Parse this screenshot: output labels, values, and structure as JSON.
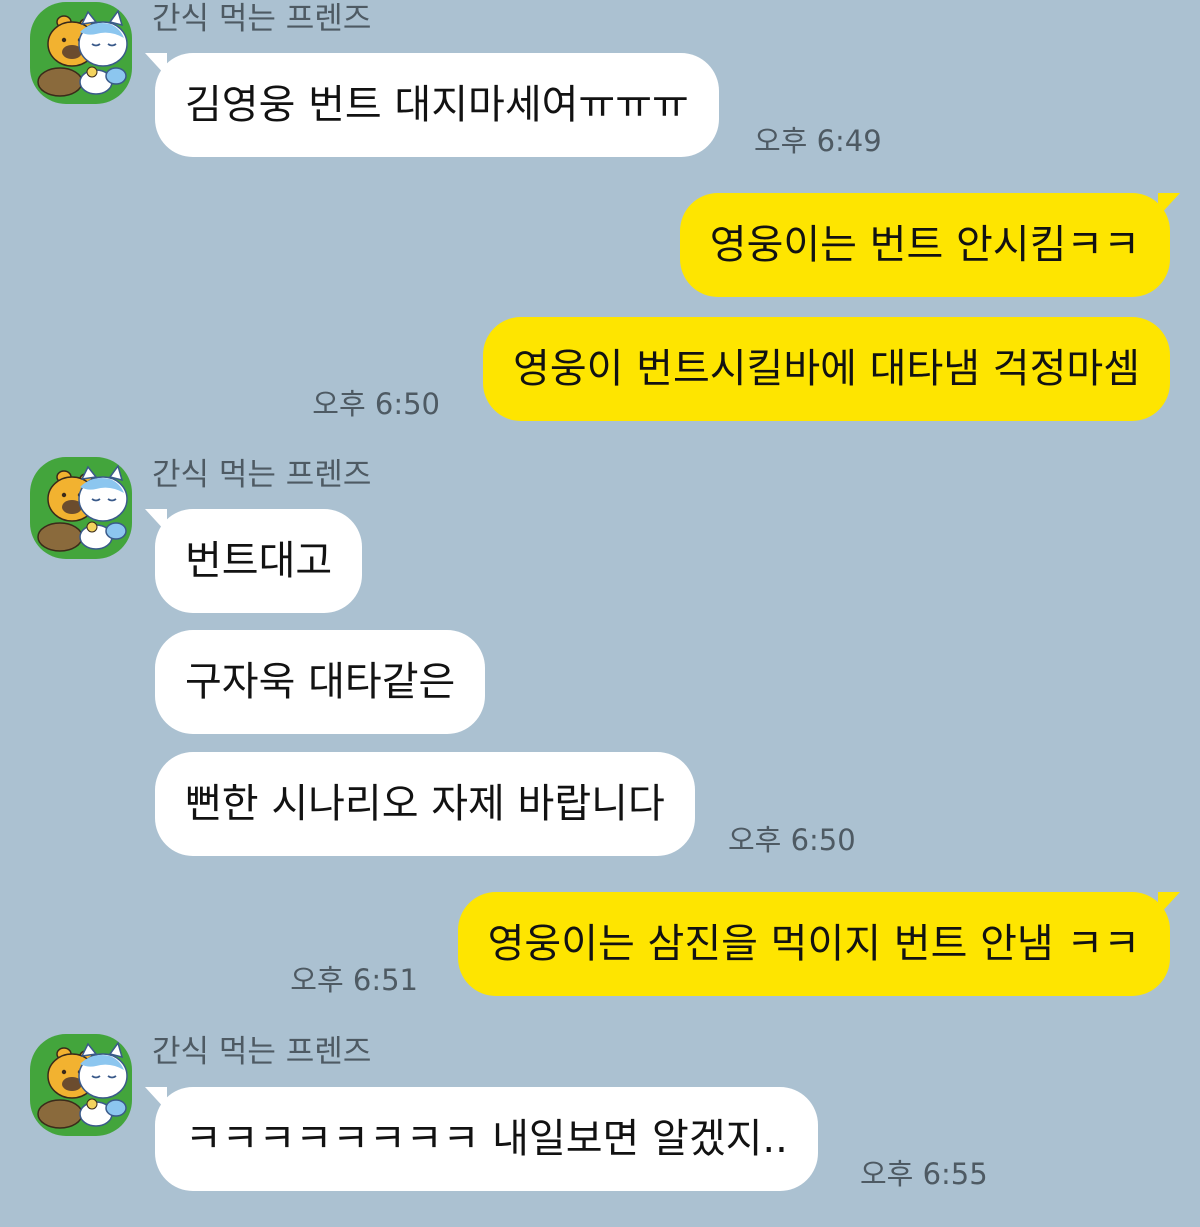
{
  "chat": {
    "friend_name": "간식 먹는 프렌즈",
    "groups": [
      {
        "sender": "간식 먹는 프렌즈",
        "messages": [
          "김영웅 번트 대지마세여ㅠㅠㅠ"
        ],
        "time": "오후 6:49"
      },
      {
        "sender": "me",
        "messages": [
          "영웅이는 번트 안시킴ㅋㅋ",
          "영웅이 번트시킬바에 대타냄 걱정마셈"
        ],
        "time": "오후 6:50"
      },
      {
        "sender": "간식 먹는 프렌즈",
        "messages": [
          "번트대고",
          "구자욱 대타같은",
          "뻔한 시나리오 자제 바랍니다"
        ],
        "time": "오후 6:50"
      },
      {
        "sender": "me",
        "messages": [
          "영웅이는 삼진을 먹이지 번트 안냄 ㅋㅋ"
        ],
        "time": "오후 6:51"
      },
      {
        "sender": "간식 먹는 프렌즈",
        "messages": [
          "ㅋㅋㅋㅋㅋㅋㅋㅋ 내일보면 알겠지.."
        ],
        "time": "오후 6:55"
      }
    ]
  },
  "colors": {
    "background": "#abc1d1",
    "incoming_bubble": "#ffffff",
    "outgoing_bubble": "#fee500",
    "avatar_bg": "#43a53c",
    "meta_text": "#4e5a63"
  },
  "icons": {
    "avatar": "friends-snack-avatar-icon"
  }
}
